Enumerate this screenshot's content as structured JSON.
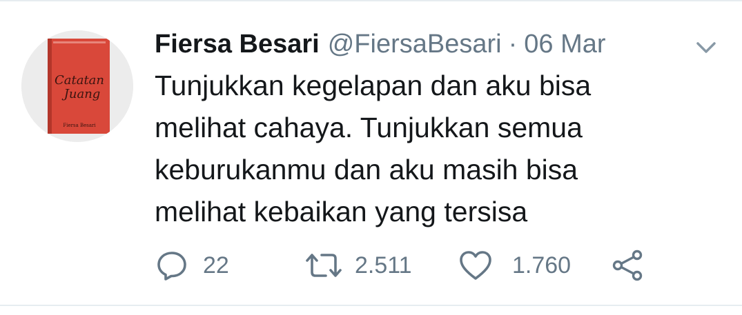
{
  "user": {
    "name": "Fiersa Besari",
    "handle": "@FiersaBesari",
    "separator": "·",
    "date": "06 Mar"
  },
  "avatar": {
    "book_title_line1": "Catatan",
    "book_title_line2": "Juang",
    "book_author": "Fiersa Besari",
    "book_color": "#d9483a"
  },
  "tweet": {
    "lines": [
      "Tunjukkan kegelapan dan aku bisa",
      "melihat cahaya. Tunjukkan semua",
      "keburukanmu dan aku masih bisa",
      "melihat kebaikan yang tersisa"
    ]
  },
  "actions": {
    "replies": "22",
    "retweets": "2.511",
    "likes": "1.760",
    "icons": [
      "reply-icon",
      "retweet-icon",
      "like-icon",
      "share-icon"
    ]
  },
  "colors": {
    "text": "#14171a",
    "secondary": "#657786",
    "divider": "#e6ecf0"
  }
}
